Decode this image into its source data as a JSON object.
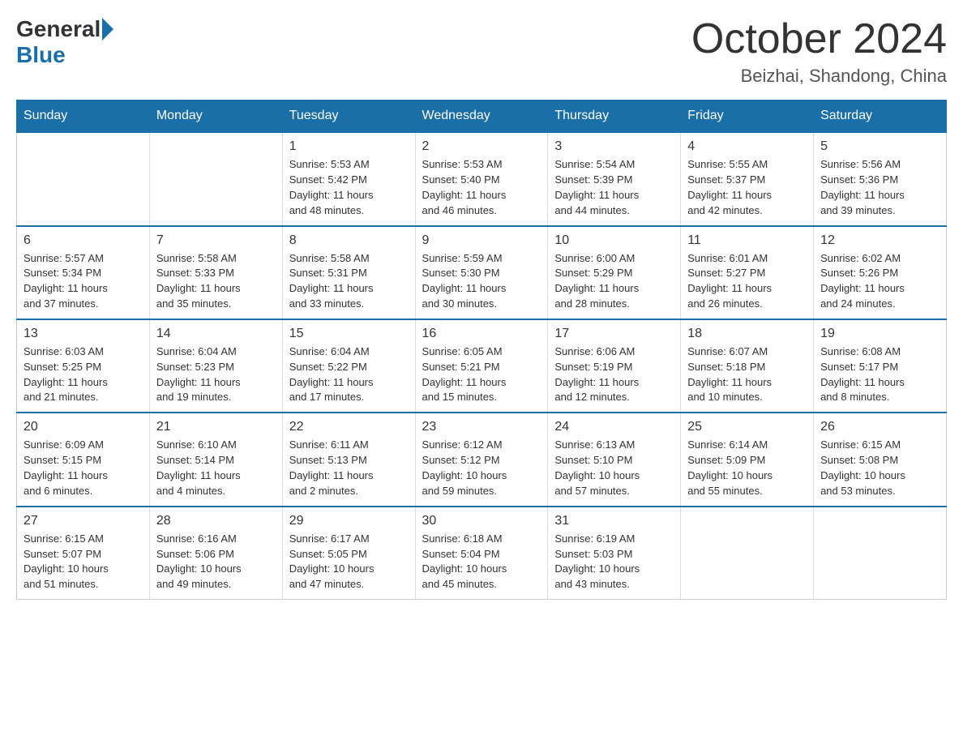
{
  "header": {
    "logo": {
      "general": "General",
      "blue": "Blue"
    },
    "title": "October 2024",
    "subtitle": "Beizhai, Shandong, China"
  },
  "days_of_week": [
    "Sunday",
    "Monday",
    "Tuesday",
    "Wednesday",
    "Thursday",
    "Friday",
    "Saturday"
  ],
  "weeks": [
    [
      {
        "day": "",
        "info": ""
      },
      {
        "day": "",
        "info": ""
      },
      {
        "day": "1",
        "info": "Sunrise: 5:53 AM\nSunset: 5:42 PM\nDaylight: 11 hours\nand 48 minutes."
      },
      {
        "day": "2",
        "info": "Sunrise: 5:53 AM\nSunset: 5:40 PM\nDaylight: 11 hours\nand 46 minutes."
      },
      {
        "day": "3",
        "info": "Sunrise: 5:54 AM\nSunset: 5:39 PM\nDaylight: 11 hours\nand 44 minutes."
      },
      {
        "day": "4",
        "info": "Sunrise: 5:55 AM\nSunset: 5:37 PM\nDaylight: 11 hours\nand 42 minutes."
      },
      {
        "day": "5",
        "info": "Sunrise: 5:56 AM\nSunset: 5:36 PM\nDaylight: 11 hours\nand 39 minutes."
      }
    ],
    [
      {
        "day": "6",
        "info": "Sunrise: 5:57 AM\nSunset: 5:34 PM\nDaylight: 11 hours\nand 37 minutes."
      },
      {
        "day": "7",
        "info": "Sunrise: 5:58 AM\nSunset: 5:33 PM\nDaylight: 11 hours\nand 35 minutes."
      },
      {
        "day": "8",
        "info": "Sunrise: 5:58 AM\nSunset: 5:31 PM\nDaylight: 11 hours\nand 33 minutes."
      },
      {
        "day": "9",
        "info": "Sunrise: 5:59 AM\nSunset: 5:30 PM\nDaylight: 11 hours\nand 30 minutes."
      },
      {
        "day": "10",
        "info": "Sunrise: 6:00 AM\nSunset: 5:29 PM\nDaylight: 11 hours\nand 28 minutes."
      },
      {
        "day": "11",
        "info": "Sunrise: 6:01 AM\nSunset: 5:27 PM\nDaylight: 11 hours\nand 26 minutes."
      },
      {
        "day": "12",
        "info": "Sunrise: 6:02 AM\nSunset: 5:26 PM\nDaylight: 11 hours\nand 24 minutes."
      }
    ],
    [
      {
        "day": "13",
        "info": "Sunrise: 6:03 AM\nSunset: 5:25 PM\nDaylight: 11 hours\nand 21 minutes."
      },
      {
        "day": "14",
        "info": "Sunrise: 6:04 AM\nSunset: 5:23 PM\nDaylight: 11 hours\nand 19 minutes."
      },
      {
        "day": "15",
        "info": "Sunrise: 6:04 AM\nSunset: 5:22 PM\nDaylight: 11 hours\nand 17 minutes."
      },
      {
        "day": "16",
        "info": "Sunrise: 6:05 AM\nSunset: 5:21 PM\nDaylight: 11 hours\nand 15 minutes."
      },
      {
        "day": "17",
        "info": "Sunrise: 6:06 AM\nSunset: 5:19 PM\nDaylight: 11 hours\nand 12 minutes."
      },
      {
        "day": "18",
        "info": "Sunrise: 6:07 AM\nSunset: 5:18 PM\nDaylight: 11 hours\nand 10 minutes."
      },
      {
        "day": "19",
        "info": "Sunrise: 6:08 AM\nSunset: 5:17 PM\nDaylight: 11 hours\nand 8 minutes."
      }
    ],
    [
      {
        "day": "20",
        "info": "Sunrise: 6:09 AM\nSunset: 5:15 PM\nDaylight: 11 hours\nand 6 minutes."
      },
      {
        "day": "21",
        "info": "Sunrise: 6:10 AM\nSunset: 5:14 PM\nDaylight: 11 hours\nand 4 minutes."
      },
      {
        "day": "22",
        "info": "Sunrise: 6:11 AM\nSunset: 5:13 PM\nDaylight: 11 hours\nand 2 minutes."
      },
      {
        "day": "23",
        "info": "Sunrise: 6:12 AM\nSunset: 5:12 PM\nDaylight: 10 hours\nand 59 minutes."
      },
      {
        "day": "24",
        "info": "Sunrise: 6:13 AM\nSunset: 5:10 PM\nDaylight: 10 hours\nand 57 minutes."
      },
      {
        "day": "25",
        "info": "Sunrise: 6:14 AM\nSunset: 5:09 PM\nDaylight: 10 hours\nand 55 minutes."
      },
      {
        "day": "26",
        "info": "Sunrise: 6:15 AM\nSunset: 5:08 PM\nDaylight: 10 hours\nand 53 minutes."
      }
    ],
    [
      {
        "day": "27",
        "info": "Sunrise: 6:15 AM\nSunset: 5:07 PM\nDaylight: 10 hours\nand 51 minutes."
      },
      {
        "day": "28",
        "info": "Sunrise: 6:16 AM\nSunset: 5:06 PM\nDaylight: 10 hours\nand 49 minutes."
      },
      {
        "day": "29",
        "info": "Sunrise: 6:17 AM\nSunset: 5:05 PM\nDaylight: 10 hours\nand 47 minutes."
      },
      {
        "day": "30",
        "info": "Sunrise: 6:18 AM\nSunset: 5:04 PM\nDaylight: 10 hours\nand 45 minutes."
      },
      {
        "day": "31",
        "info": "Sunrise: 6:19 AM\nSunset: 5:03 PM\nDaylight: 10 hours\nand 43 minutes."
      },
      {
        "day": "",
        "info": ""
      },
      {
        "day": "",
        "info": ""
      }
    ]
  ]
}
